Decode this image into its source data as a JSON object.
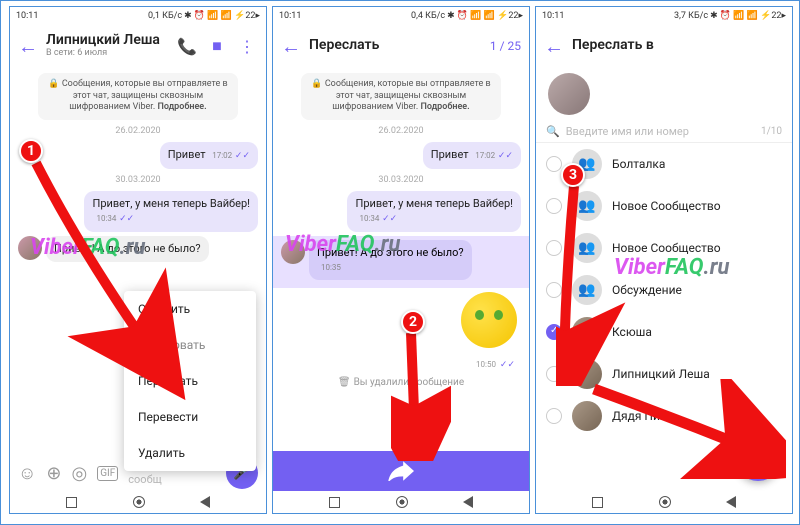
{
  "status": {
    "time": "10:11",
    "net1": "0,1 КБ/с",
    "net2": "0,4 КБ/с",
    "net3": "3,7 КБ/с",
    "icons": "⋮ W ⏱ ✕ ↕ 📶 ⚡22"
  },
  "p1": {
    "header": {
      "title": "Липницкий Леша",
      "subtitle": "В сети: 6 июля"
    },
    "enc": "🔒 Сообщения, которые вы отправляете в этот чат, защищены сквозным шифрованием Viber.",
    "enc_more": "Подробнее.",
    "date1": "26.02.2020",
    "m1": {
      "text": "Привет",
      "time": "17:02"
    },
    "date2": "30.03.2020",
    "m2": {
      "text": "Привет, у меня теперь Вайбер!",
      "time": "10:34"
    },
    "m3": {
      "text": "Привет! А до этого не было?",
      "time": ""
    },
    "menu": {
      "reply": "Ответить",
      "copy": "Копировать",
      "forward": "Переслать",
      "translate": "Перевести",
      "delete": "Удалить"
    },
    "placeholder": "Напишите сообщ"
  },
  "p2": {
    "header": {
      "title": "Переслать",
      "counter": "1 / 25"
    },
    "enc": "🔒 Сообщения, которые вы отправляете в этот чат, защищены сквозным шифрованием Viber.",
    "enc_more": "Подробнее.",
    "date1": "26.02.2020",
    "m1": {
      "text": "Привет",
      "time": "17:02"
    },
    "date2": "30.03.2020",
    "m2": {
      "text": "Привет, у меня теперь Вайбер!",
      "time": "10:34"
    },
    "m3": {
      "text": "Привет! А до этого не было?",
      "time": "10:35"
    },
    "sticker_time": "10:50",
    "deleted": "Вы удалили сообщение"
  },
  "p3": {
    "header": {
      "title": "Переслать в"
    },
    "search_ph": "Введите имя или номер",
    "search_count": "1/10",
    "contacts": [
      {
        "name": "Болталка",
        "icon": "group"
      },
      {
        "name": "Новое Сообщество",
        "icon": "group"
      },
      {
        "name": "Новое Сообщество",
        "icon": "group"
      },
      {
        "name": "Обсуждение",
        "icon": "group"
      },
      {
        "name": "Ксюша",
        "icon": "photo",
        "checked": true
      },
      {
        "name": "Липницкий Леша",
        "icon": "photo"
      },
      {
        "name": "Дядя Пиво",
        "icon": "photo"
      }
    ]
  },
  "watermark": "ViberFAQ.ru"
}
